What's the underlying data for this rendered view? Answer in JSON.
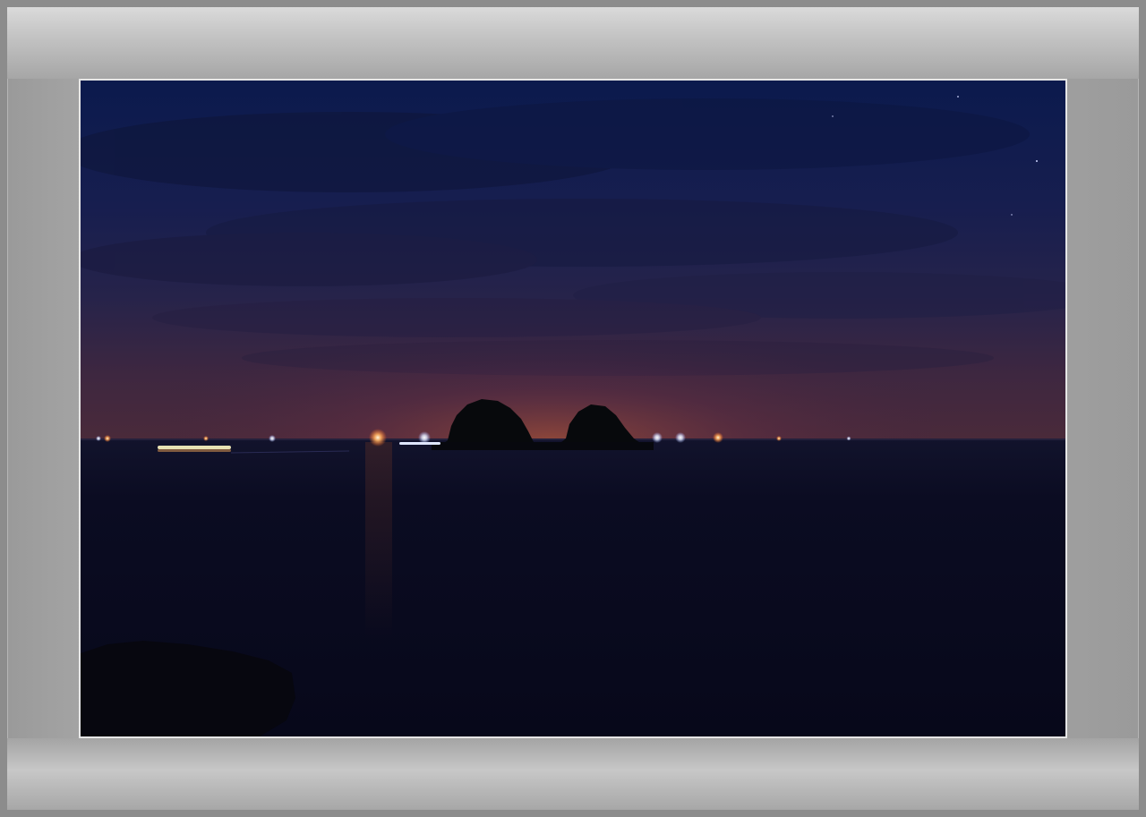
{
  "image": {
    "scene": "night-seascape",
    "colors": {
      "sky_top": "#0c1a4a",
      "sky_mid": "#1c1f4d",
      "horizon_glow": "#5a2f3e",
      "sea": "#090b1f",
      "island": "#06090c",
      "light_warm": "#ff9a3c",
      "light_white": "#fff6d8",
      "mat": "#a6a6a6",
      "outer_frame": "#8a8a8a"
    }
  }
}
